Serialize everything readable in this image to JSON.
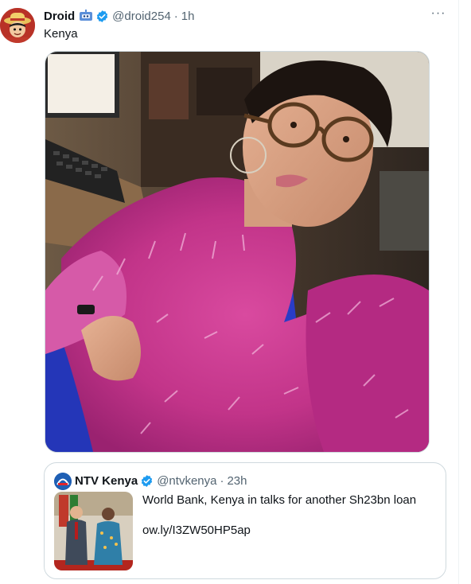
{
  "tweet": {
    "author_name": "Droid",
    "author_handle": "@droid254",
    "separator": "·",
    "time": "1h",
    "text": "Kenya",
    "more_label": "···",
    "avatar_icon": "straw-hat-character-avatar",
    "emoji_icon": "robot-emoji-icon",
    "verified_icon": "verified-badge-icon",
    "image_alt": "Selfie of a person with glasses wearing a pink fluffy coat and blue top"
  },
  "quote": {
    "author_name": "NTV Kenya",
    "author_handle": "@ntvkenya",
    "separator": "·",
    "time": "23h",
    "text": "World Bank, Kenya in talks for another Sh23bn loan",
    "link": "ow.ly/I3ZW50HP5ap",
    "avatar_icon": "ntv-logo-icon",
    "verified_icon": "verified-badge-icon"
  },
  "colors": {
    "verified": "#1d9bf0",
    "handle": "#536471",
    "border": "#cfd9de"
  }
}
